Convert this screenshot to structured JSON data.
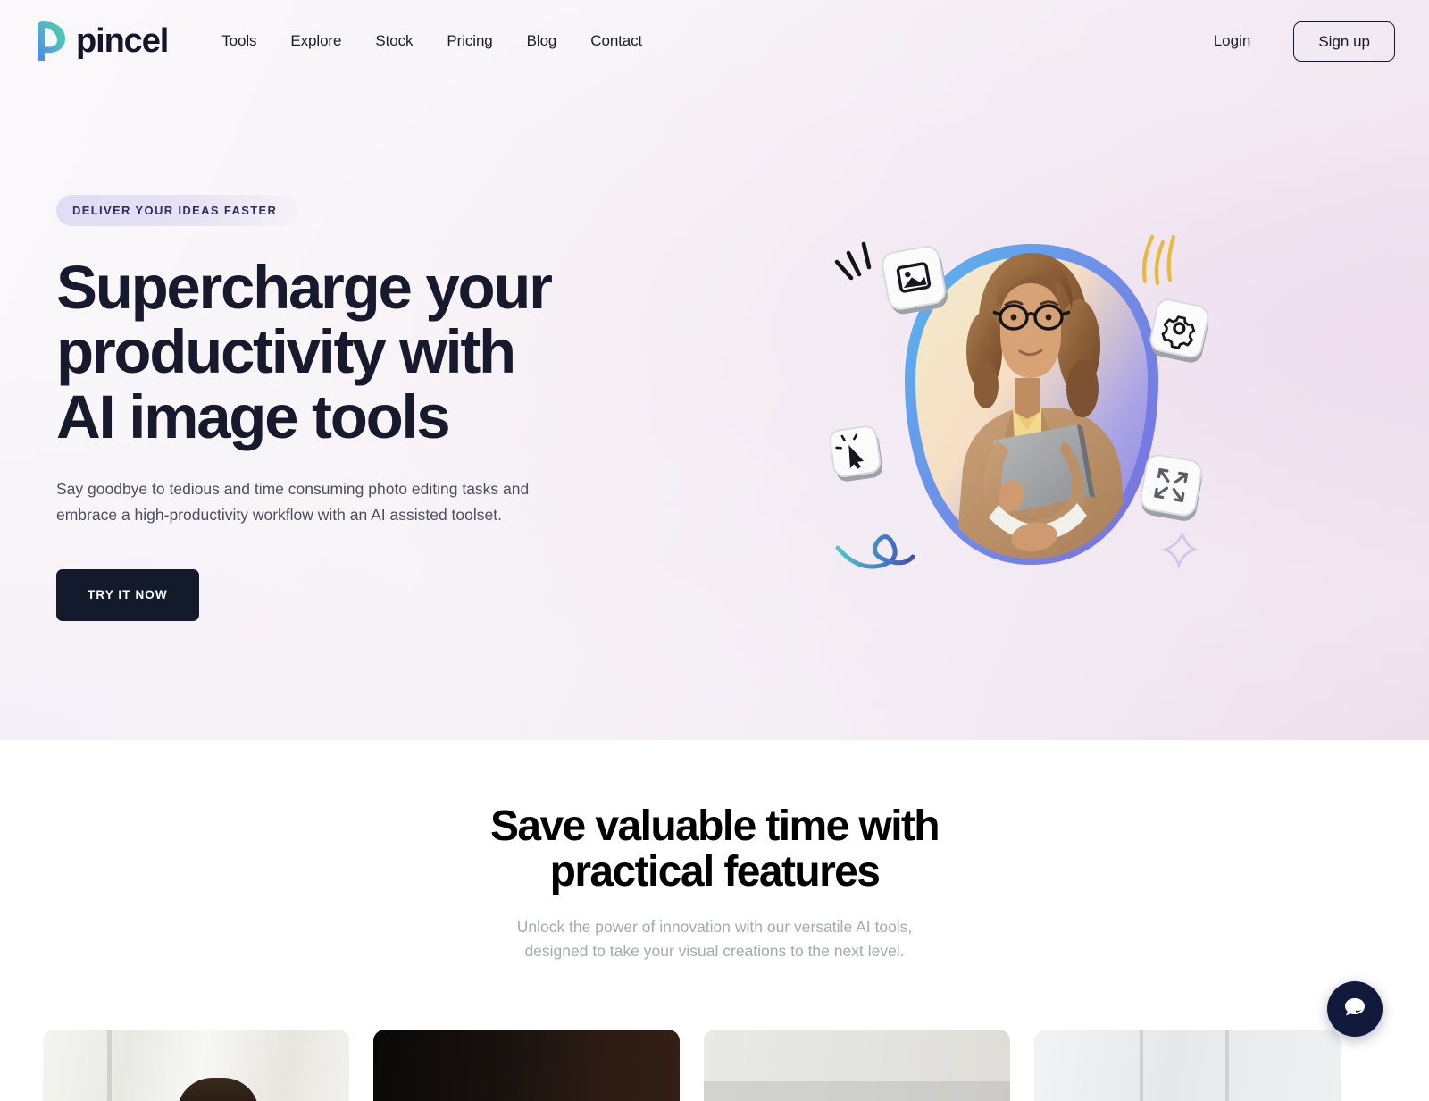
{
  "brand": {
    "name": "pincel",
    "logo_icon": "pincel-p-logo-icon"
  },
  "nav": {
    "links": [
      {
        "label": "Tools"
      },
      {
        "label": "Explore"
      },
      {
        "label": "Stock"
      },
      {
        "label": "Pricing"
      },
      {
        "label": "Blog"
      },
      {
        "label": "Contact"
      }
    ],
    "login_label": "Login",
    "signup_label": "Sign up"
  },
  "hero": {
    "badge": "DELIVER YOUR IDEAS FASTER",
    "title_line_1": "Supercharge your",
    "title_line_2": "productivity with",
    "title_line_3": "AI image tools",
    "subtitle": "Say goodbye to tedious and time consuming photo editing tasks and embrace a high-productivity workflow with an AI assisted toolset.",
    "cta_label": "TRY IT NOW",
    "art": {
      "description": "Woman with curly hair and glasses in a tan blazer holding a laptop, framed by a blue-to-purple gradient blob",
      "floating_tiles": [
        {
          "icon": "image-icon",
          "position": "top-left"
        },
        {
          "icon": "gear-icon",
          "position": "top-right"
        },
        {
          "icon": "magic-click-icon",
          "position": "bottom-left"
        },
        {
          "icon": "expand-arrows-icon",
          "position": "bottom-right"
        }
      ],
      "decorations": [
        {
          "icon": "black-spark-strokes-icon",
          "position": "top-left"
        },
        {
          "icon": "yellow-swoosh-icon",
          "position": "top-right"
        },
        {
          "icon": "blue-squiggle-icon",
          "position": "bottom-left"
        },
        {
          "icon": "sparkle-icon",
          "position": "bottom-right"
        }
      ]
    }
  },
  "features": {
    "title_line_1": "Save valuable time with",
    "title_line_2": "practical features",
    "subtitle_line_1": "Unlock the power of innovation with our versatile AI tools,",
    "subtitle_line_2": "designed to take your visual creations to the next level."
  },
  "chat": {
    "icon": "chat-bubble-icon"
  },
  "colors": {
    "brand_dark": "#14142b",
    "badge_text": "#2e2a63",
    "cta_background": "#131a2c",
    "chat_background": "#111a3d",
    "logo_gradient_start": "#4f8ff0",
    "logo_gradient_end": "#4ccfa0"
  }
}
